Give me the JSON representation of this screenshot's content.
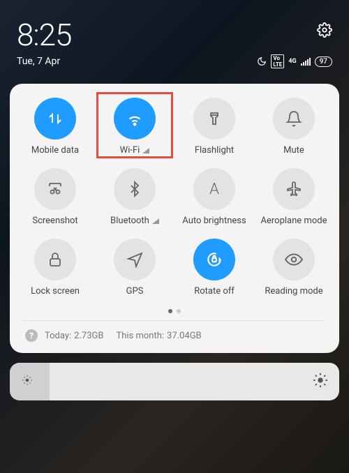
{
  "status": {
    "time": "8:25",
    "date": "Tue, 7 Apr",
    "battery": "97"
  },
  "tiles": {
    "mobile_data": {
      "label": "Mobile data",
      "on": true
    },
    "wifi": {
      "label": "Wi-Fi",
      "on": true
    },
    "flashlight": {
      "label": "Flashlight",
      "on": false
    },
    "mute": {
      "label": "Mute",
      "on": false
    },
    "screenshot": {
      "label": "Screenshot",
      "on": false
    },
    "bluetooth": {
      "label": "Bluetooth",
      "on": false
    },
    "auto_brightness": {
      "label": "Auto brightness",
      "on": false
    },
    "aeroplane": {
      "label": "Aeroplane mode",
      "on": false
    },
    "lock_screen": {
      "label": "Lock screen",
      "on": false
    },
    "gps": {
      "label": "GPS",
      "on": false
    },
    "rotate": {
      "label": "Rotate off",
      "on": true
    },
    "reading": {
      "label": "Reading mode",
      "on": false
    }
  },
  "usage": {
    "today_label": "Today:",
    "today_value": "2.73GB",
    "month_label": "This month:",
    "month_value": "37.04GB"
  }
}
